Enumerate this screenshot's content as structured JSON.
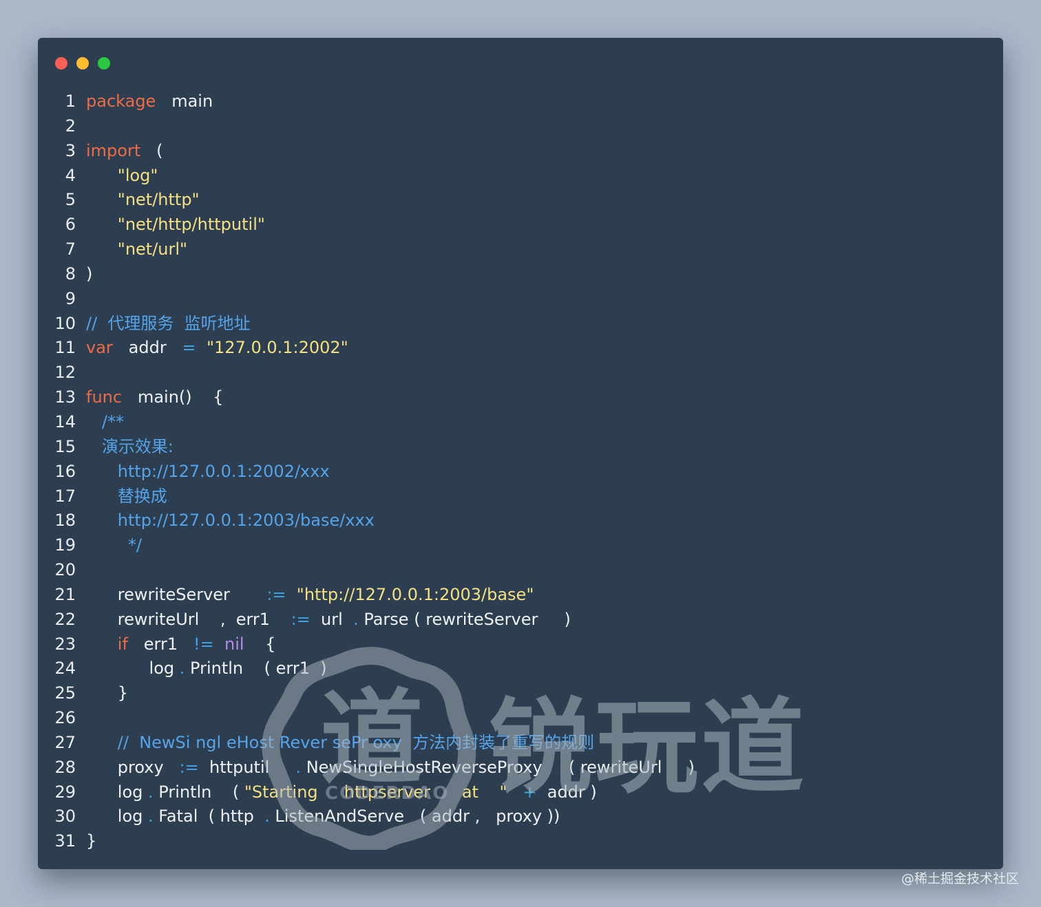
{
  "window": {
    "lights": [
      "close",
      "minimize",
      "maximize"
    ]
  },
  "code_lines": [
    {
      "n": "1",
      "tokens": [
        {
          "t": "package",
          "c": "keyword"
        },
        {
          "t": "   main",
          "c": "plain"
        }
      ]
    },
    {
      "n": "2",
      "tokens": []
    },
    {
      "n": "3",
      "tokens": [
        {
          "t": "import",
          "c": "keyword"
        },
        {
          "t": "   (",
          "c": "plain"
        }
      ]
    },
    {
      "n": "4",
      "tokens": [
        {
          "t": "      ",
          "c": "plain"
        },
        {
          "t": "\"log\"",
          "c": "string"
        }
      ]
    },
    {
      "n": "5",
      "tokens": [
        {
          "t": "      ",
          "c": "plain"
        },
        {
          "t": "\"net/http\"",
          "c": "string"
        }
      ]
    },
    {
      "n": "6",
      "tokens": [
        {
          "t": "      ",
          "c": "plain"
        },
        {
          "t": "\"net/http/httputil\"",
          "c": "string"
        }
      ]
    },
    {
      "n": "7",
      "tokens": [
        {
          "t": "      ",
          "c": "plain"
        },
        {
          "t": "\"net/url\"",
          "c": "string"
        }
      ]
    },
    {
      "n": "8",
      "tokens": [
        {
          "t": ")",
          "c": "plain"
        }
      ]
    },
    {
      "n": "9",
      "tokens": []
    },
    {
      "n": "10",
      "tokens": [
        {
          "t": "//  代理服务  监听地址",
          "c": "comment"
        }
      ]
    },
    {
      "n": "11",
      "tokens": [
        {
          "t": "var",
          "c": "keyword"
        },
        {
          "t": "   addr  ",
          "c": "plain"
        },
        {
          "t": " = ",
          "c": "op"
        },
        {
          "t": " ",
          "c": "plain"
        },
        {
          "t": "\"127.0.0.1:2002\"",
          "c": "string"
        }
      ]
    },
    {
      "n": "12",
      "tokens": []
    },
    {
      "n": "13",
      "tokens": [
        {
          "t": "func",
          "c": "keyword"
        },
        {
          "t": "   main()    {",
          "c": "plain"
        }
      ]
    },
    {
      "n": "14",
      "tokens": [
        {
          "t": "   /**",
          "c": "comment"
        }
      ]
    },
    {
      "n": "15",
      "tokens": [
        {
          "t": "   演示效果:",
          "c": "comment"
        }
      ]
    },
    {
      "n": "16",
      "tokens": [
        {
          "t": "      http://127.0.0.1:2002/xxx",
          "c": "comment"
        }
      ]
    },
    {
      "n": "17",
      "tokens": [
        {
          "t": "      替换成",
          "c": "comment"
        }
      ]
    },
    {
      "n": "18",
      "tokens": [
        {
          "t": "      http://127.0.0.1:2003/base/xxx",
          "c": "comment"
        }
      ]
    },
    {
      "n": "19",
      "tokens": [
        {
          "t": "        */",
          "c": "comment"
        }
      ]
    },
    {
      "n": "20",
      "tokens": []
    },
    {
      "n": "21",
      "tokens": [
        {
          "t": "      rewriteServer      ",
          "c": "plain"
        },
        {
          "t": " := ",
          "c": "op"
        },
        {
          "t": " ",
          "c": "plain"
        },
        {
          "t": "\"http://127.0.0.1:2003/base\"",
          "c": "string"
        }
      ]
    },
    {
      "n": "22",
      "tokens": [
        {
          "t": "      rewriteUrl    ,  err1   ",
          "c": "plain"
        },
        {
          "t": " := ",
          "c": "op"
        },
        {
          "t": " url  ",
          "c": "plain"
        },
        {
          "t": ".",
          "c": "op"
        },
        {
          "t": " Parse ( rewriteServer     )",
          "c": "plain"
        }
      ]
    },
    {
      "n": "23",
      "tokens": [
        {
          "t": "      ",
          "c": "plain"
        },
        {
          "t": "if",
          "c": "keyword"
        },
        {
          "t": "   err1   ",
          "c": "plain"
        },
        {
          "t": "!=",
          "c": "op"
        },
        {
          "t": "  ",
          "c": "plain"
        },
        {
          "t": "nil",
          "c": "nil"
        },
        {
          "t": "    {",
          "c": "plain"
        }
      ]
    },
    {
      "n": "24",
      "tokens": [
        {
          "t": "            log ",
          "c": "plain"
        },
        {
          "t": ".",
          "c": "op"
        },
        {
          "t": " Println    ( err1  )",
          "c": "plain"
        }
      ]
    },
    {
      "n": "25",
      "tokens": [
        {
          "t": "      }",
          "c": "plain"
        }
      ]
    },
    {
      "n": "26",
      "tokens": []
    },
    {
      "n": "27",
      "tokens": [
        {
          "t": "      //  NewSi ngl eHost Rever sePr oxy  方法内封装了重写的规则",
          "c": "comment"
        }
      ]
    },
    {
      "n": "28",
      "tokens": [
        {
          "t": "      proxy  ",
          "c": "plain"
        },
        {
          "t": " := ",
          "c": "op"
        },
        {
          "t": " httputil     ",
          "c": "plain"
        },
        {
          "t": ".",
          "c": "op"
        },
        {
          "t": " NewSingleHostReverseProxy     ( rewriteUrl     )",
          "c": "plain"
        }
      ]
    },
    {
      "n": "29",
      "tokens": [
        {
          "t": "      log ",
          "c": "plain"
        },
        {
          "t": ".",
          "c": "op"
        },
        {
          "t": " Println    ( ",
          "c": "plain"
        },
        {
          "t": "\"Starting     httpserver      at    \"",
          "c": "string"
        },
        {
          "t": "   ",
          "c": "plain"
        },
        {
          "t": "+",
          "c": "op"
        },
        {
          "t": "  addr )",
          "c": "plain"
        }
      ]
    },
    {
      "n": "30",
      "tokens": [
        {
          "t": "      log ",
          "c": "plain"
        },
        {
          "t": ".",
          "c": "op"
        },
        {
          "t": " Fatal  ( http  ",
          "c": "plain"
        },
        {
          "t": ".",
          "c": "op"
        },
        {
          "t": " ListenAndServe   ( addr ,   proxy ))",
          "c": "plain"
        }
      ]
    },
    {
      "n": "31",
      "tokens": [
        {
          "t": "}",
          "c": "plain"
        }
      ]
    }
  ],
  "watermark": {
    "brand": "锐玩道",
    "seal_char": "道",
    "sub": "CODERDAO"
  },
  "footer": {
    "credit": "@稀土掘金技术社区"
  }
}
